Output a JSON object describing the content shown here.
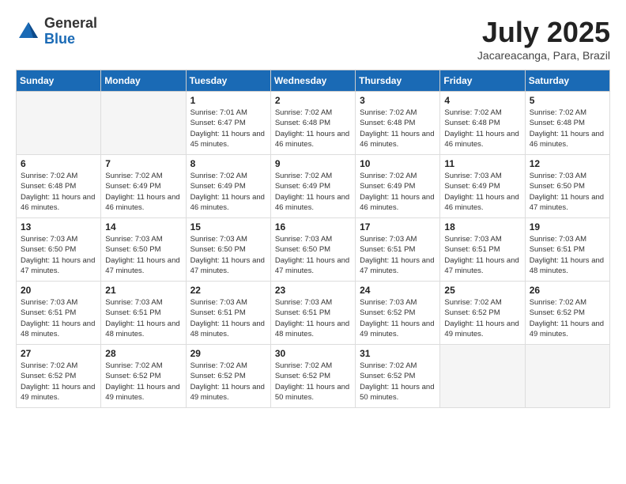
{
  "logo": {
    "general": "General",
    "blue": "Blue"
  },
  "title": "July 2025",
  "subtitle": "Jacareacanga, Para, Brazil",
  "days_of_week": [
    "Sunday",
    "Monday",
    "Tuesday",
    "Wednesday",
    "Thursday",
    "Friday",
    "Saturday"
  ],
  "weeks": [
    [
      {
        "day": "",
        "empty": true
      },
      {
        "day": "",
        "empty": true
      },
      {
        "day": "1",
        "sunrise": "Sunrise: 7:01 AM",
        "sunset": "Sunset: 6:47 PM",
        "daylight": "Daylight: 11 hours and 45 minutes."
      },
      {
        "day": "2",
        "sunrise": "Sunrise: 7:02 AM",
        "sunset": "Sunset: 6:48 PM",
        "daylight": "Daylight: 11 hours and 46 minutes."
      },
      {
        "day": "3",
        "sunrise": "Sunrise: 7:02 AM",
        "sunset": "Sunset: 6:48 PM",
        "daylight": "Daylight: 11 hours and 46 minutes."
      },
      {
        "day": "4",
        "sunrise": "Sunrise: 7:02 AM",
        "sunset": "Sunset: 6:48 PM",
        "daylight": "Daylight: 11 hours and 46 minutes."
      },
      {
        "day": "5",
        "sunrise": "Sunrise: 7:02 AM",
        "sunset": "Sunset: 6:48 PM",
        "daylight": "Daylight: 11 hours and 46 minutes."
      }
    ],
    [
      {
        "day": "6",
        "sunrise": "Sunrise: 7:02 AM",
        "sunset": "Sunset: 6:48 PM",
        "daylight": "Daylight: 11 hours and 46 minutes."
      },
      {
        "day": "7",
        "sunrise": "Sunrise: 7:02 AM",
        "sunset": "Sunset: 6:49 PM",
        "daylight": "Daylight: 11 hours and 46 minutes."
      },
      {
        "day": "8",
        "sunrise": "Sunrise: 7:02 AM",
        "sunset": "Sunset: 6:49 PM",
        "daylight": "Daylight: 11 hours and 46 minutes."
      },
      {
        "day": "9",
        "sunrise": "Sunrise: 7:02 AM",
        "sunset": "Sunset: 6:49 PM",
        "daylight": "Daylight: 11 hours and 46 minutes."
      },
      {
        "day": "10",
        "sunrise": "Sunrise: 7:02 AM",
        "sunset": "Sunset: 6:49 PM",
        "daylight": "Daylight: 11 hours and 46 minutes."
      },
      {
        "day": "11",
        "sunrise": "Sunrise: 7:03 AM",
        "sunset": "Sunset: 6:49 PM",
        "daylight": "Daylight: 11 hours and 46 minutes."
      },
      {
        "day": "12",
        "sunrise": "Sunrise: 7:03 AM",
        "sunset": "Sunset: 6:50 PM",
        "daylight": "Daylight: 11 hours and 47 minutes."
      }
    ],
    [
      {
        "day": "13",
        "sunrise": "Sunrise: 7:03 AM",
        "sunset": "Sunset: 6:50 PM",
        "daylight": "Daylight: 11 hours and 47 minutes."
      },
      {
        "day": "14",
        "sunrise": "Sunrise: 7:03 AM",
        "sunset": "Sunset: 6:50 PM",
        "daylight": "Daylight: 11 hours and 47 minutes."
      },
      {
        "day": "15",
        "sunrise": "Sunrise: 7:03 AM",
        "sunset": "Sunset: 6:50 PM",
        "daylight": "Daylight: 11 hours and 47 minutes."
      },
      {
        "day": "16",
        "sunrise": "Sunrise: 7:03 AM",
        "sunset": "Sunset: 6:50 PM",
        "daylight": "Daylight: 11 hours and 47 minutes."
      },
      {
        "day": "17",
        "sunrise": "Sunrise: 7:03 AM",
        "sunset": "Sunset: 6:51 PM",
        "daylight": "Daylight: 11 hours and 47 minutes."
      },
      {
        "day": "18",
        "sunrise": "Sunrise: 7:03 AM",
        "sunset": "Sunset: 6:51 PM",
        "daylight": "Daylight: 11 hours and 47 minutes."
      },
      {
        "day": "19",
        "sunrise": "Sunrise: 7:03 AM",
        "sunset": "Sunset: 6:51 PM",
        "daylight": "Daylight: 11 hours and 48 minutes."
      }
    ],
    [
      {
        "day": "20",
        "sunrise": "Sunrise: 7:03 AM",
        "sunset": "Sunset: 6:51 PM",
        "daylight": "Daylight: 11 hours and 48 minutes."
      },
      {
        "day": "21",
        "sunrise": "Sunrise: 7:03 AM",
        "sunset": "Sunset: 6:51 PM",
        "daylight": "Daylight: 11 hours and 48 minutes."
      },
      {
        "day": "22",
        "sunrise": "Sunrise: 7:03 AM",
        "sunset": "Sunset: 6:51 PM",
        "daylight": "Daylight: 11 hours and 48 minutes."
      },
      {
        "day": "23",
        "sunrise": "Sunrise: 7:03 AM",
        "sunset": "Sunset: 6:51 PM",
        "daylight": "Daylight: 11 hours and 48 minutes."
      },
      {
        "day": "24",
        "sunrise": "Sunrise: 7:03 AM",
        "sunset": "Sunset: 6:52 PM",
        "daylight": "Daylight: 11 hours and 49 minutes."
      },
      {
        "day": "25",
        "sunrise": "Sunrise: 7:02 AM",
        "sunset": "Sunset: 6:52 PM",
        "daylight": "Daylight: 11 hours and 49 minutes."
      },
      {
        "day": "26",
        "sunrise": "Sunrise: 7:02 AM",
        "sunset": "Sunset: 6:52 PM",
        "daylight": "Daylight: 11 hours and 49 minutes."
      }
    ],
    [
      {
        "day": "27",
        "sunrise": "Sunrise: 7:02 AM",
        "sunset": "Sunset: 6:52 PM",
        "daylight": "Daylight: 11 hours and 49 minutes."
      },
      {
        "day": "28",
        "sunrise": "Sunrise: 7:02 AM",
        "sunset": "Sunset: 6:52 PM",
        "daylight": "Daylight: 11 hours and 49 minutes."
      },
      {
        "day": "29",
        "sunrise": "Sunrise: 7:02 AM",
        "sunset": "Sunset: 6:52 PM",
        "daylight": "Daylight: 11 hours and 49 minutes."
      },
      {
        "day": "30",
        "sunrise": "Sunrise: 7:02 AM",
        "sunset": "Sunset: 6:52 PM",
        "daylight": "Daylight: 11 hours and 50 minutes."
      },
      {
        "day": "31",
        "sunrise": "Sunrise: 7:02 AM",
        "sunset": "Sunset: 6:52 PM",
        "daylight": "Daylight: 11 hours and 50 minutes."
      },
      {
        "day": "",
        "empty": true
      },
      {
        "day": "",
        "empty": true
      }
    ]
  ]
}
